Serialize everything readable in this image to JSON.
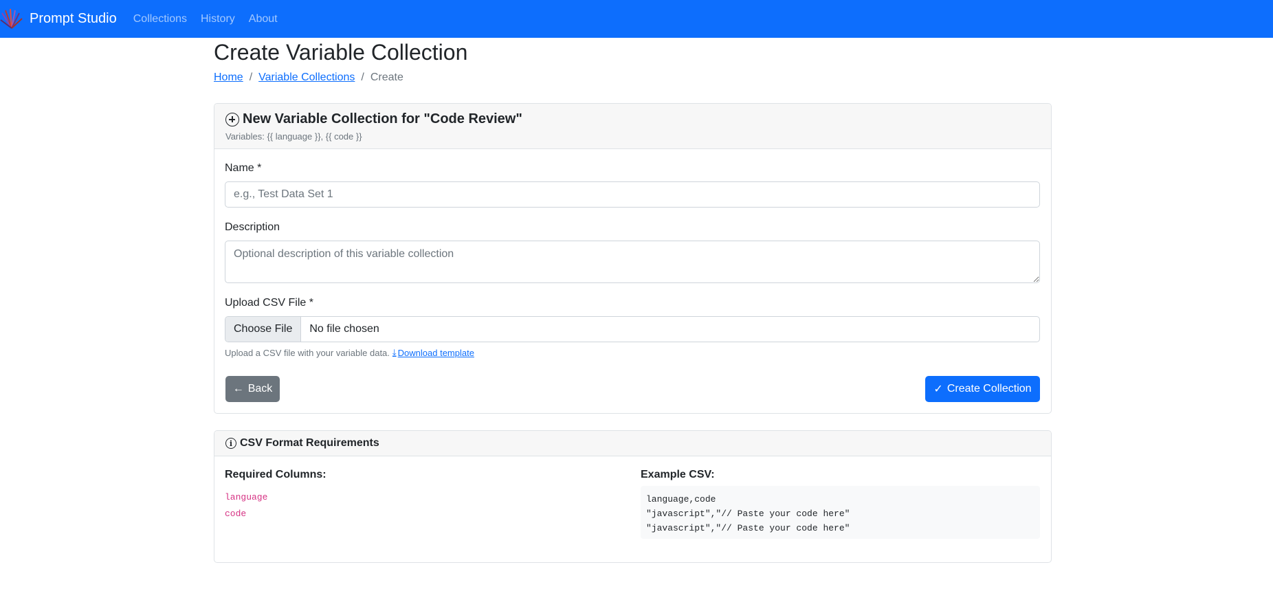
{
  "navbar": {
    "brand": "Prompt Studio",
    "links": [
      "Collections",
      "History",
      "About"
    ],
    "bg_color": "#0d6efd"
  },
  "page": {
    "title": "Create Variable Collection",
    "breadcrumb": {
      "home": "Home",
      "collections": "Variable Collections",
      "current": "Create",
      "separator": "/"
    }
  },
  "form_card": {
    "title": "New Variable Collection for \"Code Review\"",
    "subtitle": "Variables: {{ language }}, {{ code }}",
    "name_label": "Name *",
    "name_placeholder": "e.g., Test Data Set 1",
    "description_label": "Description",
    "description_placeholder": "Optional description of this variable collection",
    "csv_label": "Upload CSV File *",
    "file_button": "Choose File",
    "file_status": "No file chosen",
    "help_text": "Upload a CSV file with your variable data.",
    "download_link": "Download template",
    "back_button": "Back",
    "create_button": "Create Collection"
  },
  "csv_card": {
    "title": "CSV Format Requirements",
    "required_title": "Required Columns:",
    "columns": [
      "language",
      "code"
    ],
    "example_title": "Example CSV:",
    "example_lines": [
      "language,code",
      "\"javascript\",\"// Paste your code here\"",
      "\"javascript\",\"// Paste your code here\""
    ]
  },
  "colors": {
    "primary": "#0d6efd",
    "secondary": "#6c757d",
    "code_pink": "#d63384"
  }
}
